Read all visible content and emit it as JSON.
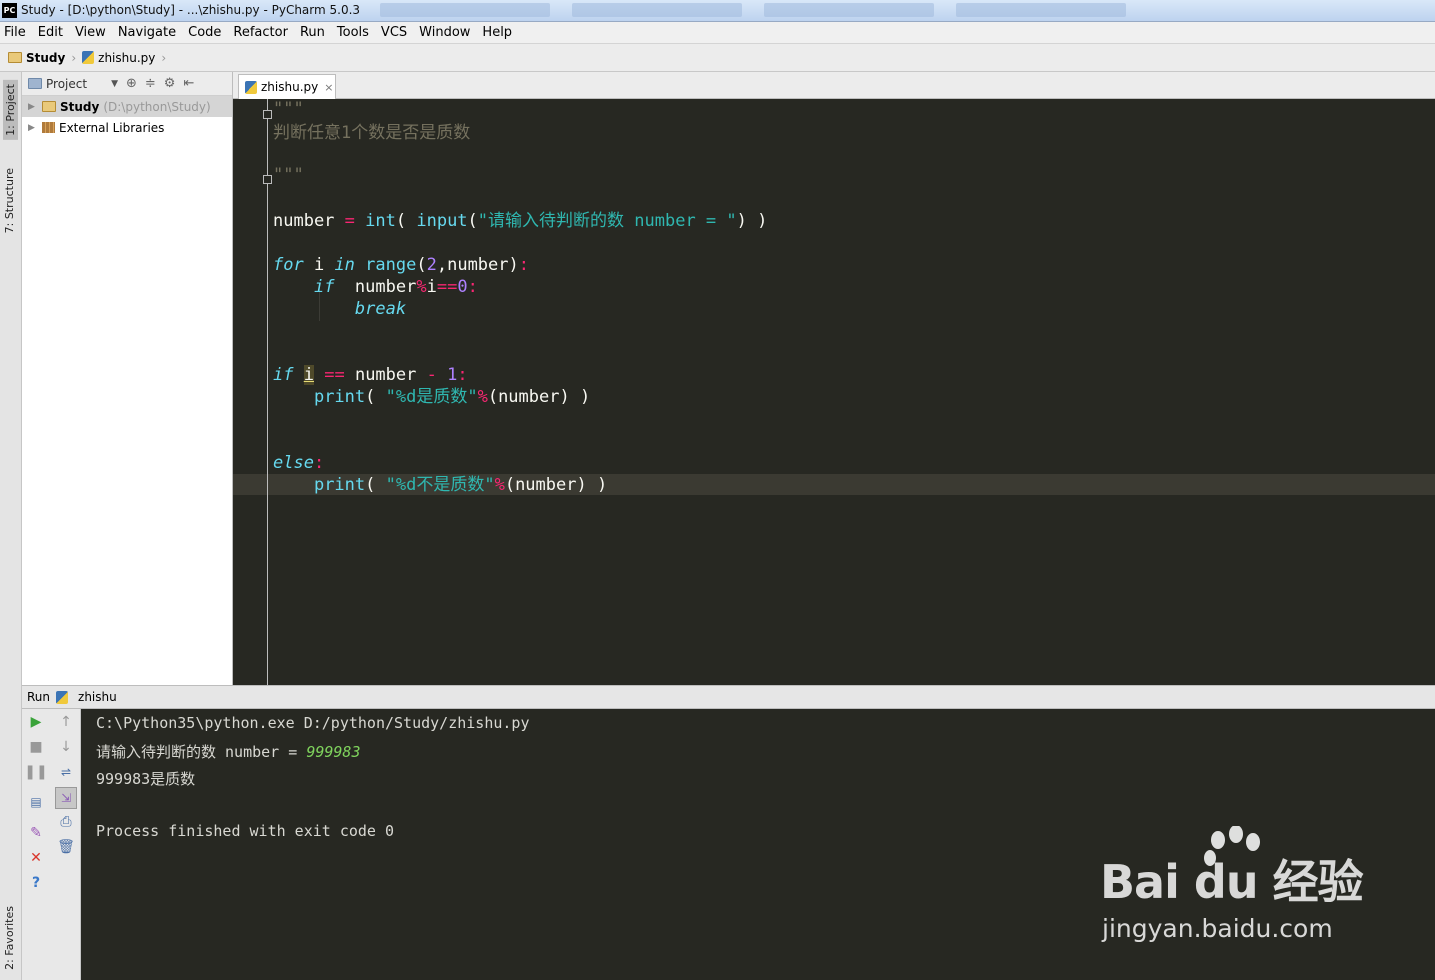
{
  "window": {
    "title": "Study - [D:\\python\\Study] - ...\\zhishu.py - PyCharm 5.0.3",
    "logo": "PC"
  },
  "menu": [
    "File",
    "Edit",
    "View",
    "Navigate",
    "Code",
    "Refactor",
    "Run",
    "Tools",
    "VCS",
    "Window",
    "Help"
  ],
  "breadcrumb": {
    "project": "Study",
    "file": "zhishu.py"
  },
  "side_tabs": {
    "project": "1: Project",
    "structure": "7: Structure",
    "favorites": "2: Favorites"
  },
  "project_panel": {
    "view_label": "Project",
    "tree": [
      {
        "label": "Study",
        "path": "(D:\\python\\Study)"
      },
      {
        "label": "External Libraries",
        "path": ""
      }
    ]
  },
  "editor": {
    "tab_label": "zhishu.py",
    "close_glyph": "×"
  },
  "run_panel": {
    "label": "Run",
    "config": "zhishu",
    "console": {
      "command": "C:\\Python35\\python.exe D:/python/Study/zhishu.py",
      "prompt": "请输入待判断的数 number = ",
      "input": "999983",
      "result": "999983是质数",
      "exit": "Process finished with exit code 0"
    }
  },
  "watermark": {
    "brand": "Bai du 经验",
    "url": "jingyan.baidu.com"
  }
}
